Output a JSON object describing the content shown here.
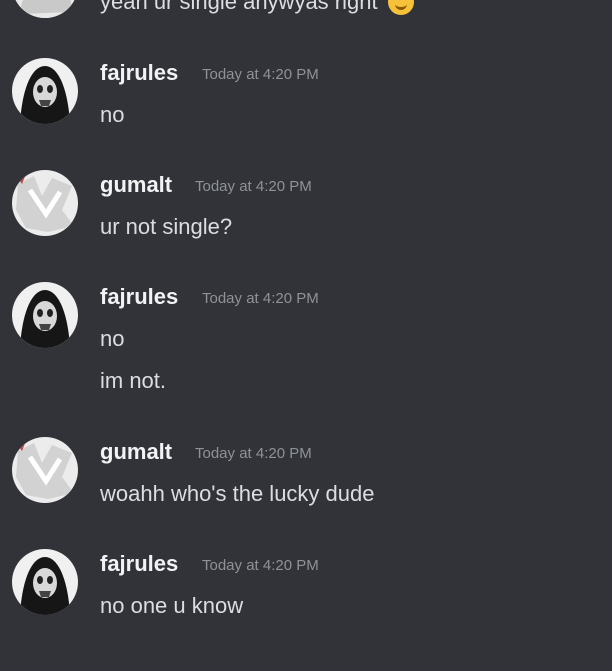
{
  "colors": {
    "background": "#313338",
    "username": "#f2f3f5",
    "message_text": "#dbdee1",
    "timestamp": "#8e9297"
  },
  "partial_message": {
    "text": "yeah ur single anywyas right",
    "emoji": "thinking-emoji"
  },
  "messages": [
    {
      "author": "fajrules",
      "time": "Today at 4:20 PM",
      "lines": [
        "no"
      ],
      "avatar": "dark-avatar-icon"
    },
    {
      "author": "gumalt",
      "time": "Today at 4:20 PM",
      "lines": [
        "ur not single?"
      ],
      "avatar": "white-avatar-icon"
    },
    {
      "author": "fajrules",
      "time": "Today at 4:20 PM",
      "lines": [
        "no",
        "im not."
      ],
      "avatar": "dark-avatar-icon"
    },
    {
      "author": "gumalt",
      "time": "Today at 4:20 PM",
      "lines": [
        "woahh who's the lucky dude"
      ],
      "avatar": "white-avatar-icon"
    },
    {
      "author": "fajrules",
      "time": "Today at 4:20 PM",
      "lines": [
        "no one u know"
      ],
      "avatar": "dark-avatar-icon"
    }
  ]
}
